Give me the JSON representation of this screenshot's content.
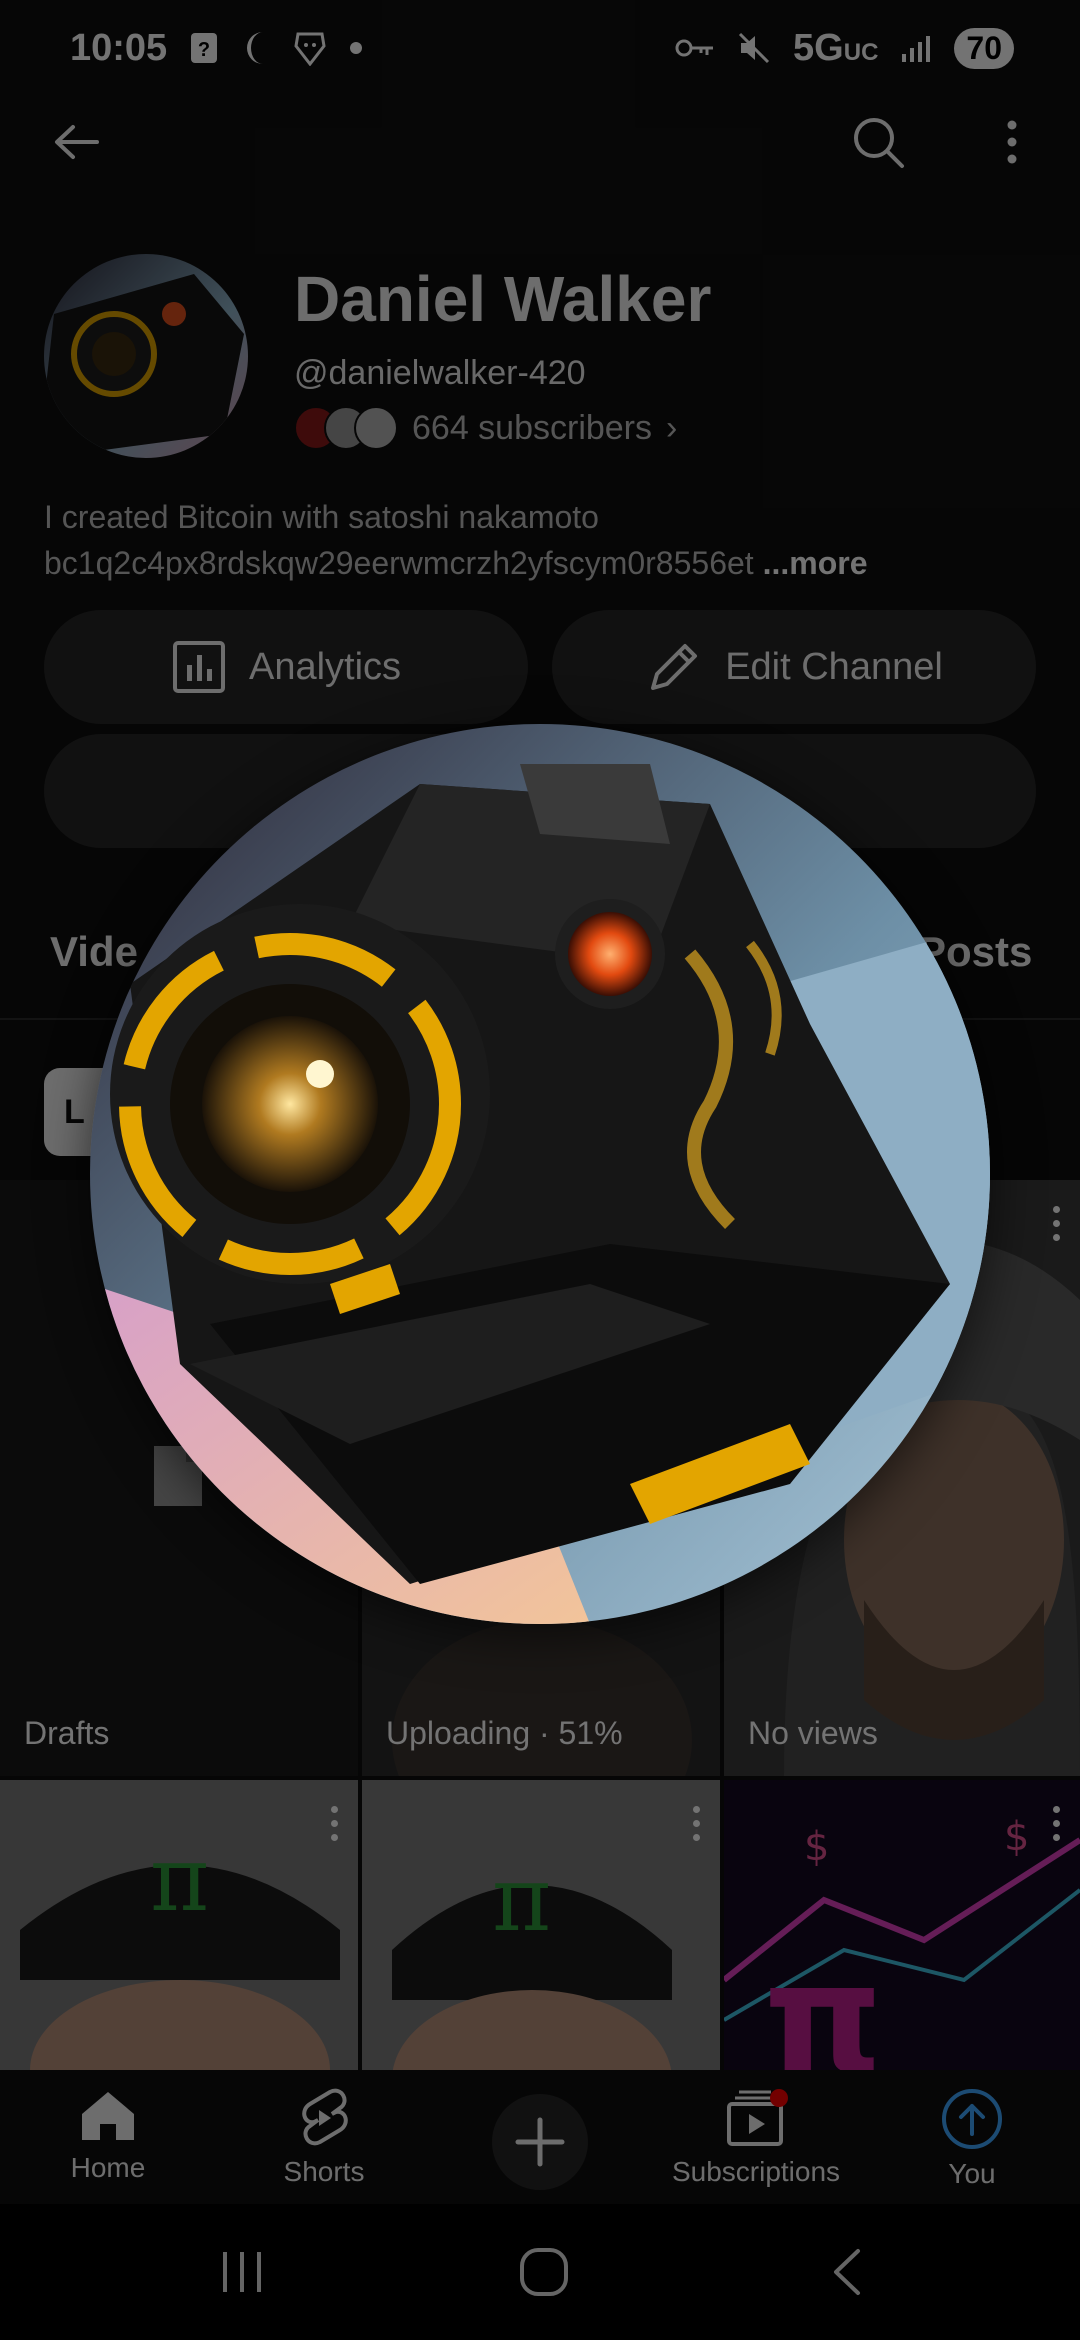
{
  "status_bar": {
    "time": "10:05",
    "network": "5G",
    "network_suffix": "UC",
    "battery": "70"
  },
  "channel": {
    "name": "Daniel Walker",
    "handle": "@danielwalker-420",
    "subscribers": "664 subscribers",
    "subscribers_chevron": "›",
    "bio_line1": "I created Bitcoin with satoshi nakamoto",
    "bio_line2": "bc1q2c4px8rdskqw29eerwmcrzh2yfscym0r8556et",
    "bio_more": "...more"
  },
  "actions": {
    "analytics_label": "Analytics",
    "edit_label": "Edit Channel"
  },
  "tabs": {
    "videos_label": "Vide",
    "posts_label": "Posts"
  },
  "chip": {
    "label": "L"
  },
  "grid": {
    "cells": [
      {
        "label": "Drafts"
      },
      {
        "label": "Uploading · 51%"
      },
      {
        "label": "No views"
      }
    ]
  },
  "bottom_nav": {
    "home": "Home",
    "shorts": "Shorts",
    "subscriptions": "Subscriptions",
    "you": "You"
  },
  "icons": {
    "back": "back-arrow-icon",
    "search": "search-icon",
    "more": "more-vert-icon",
    "analytics": "analytics-icon",
    "edit": "pencil-icon",
    "home": "home-icon",
    "shorts": "shorts-icon",
    "create": "plus-icon",
    "subscriptions": "subscriptions-icon",
    "you": "you-icon"
  },
  "colors": {
    "background": "#0f0f0f",
    "pill": "#272727",
    "accent_blue": "#3ea6ff",
    "notification_red": "#ff0000"
  }
}
